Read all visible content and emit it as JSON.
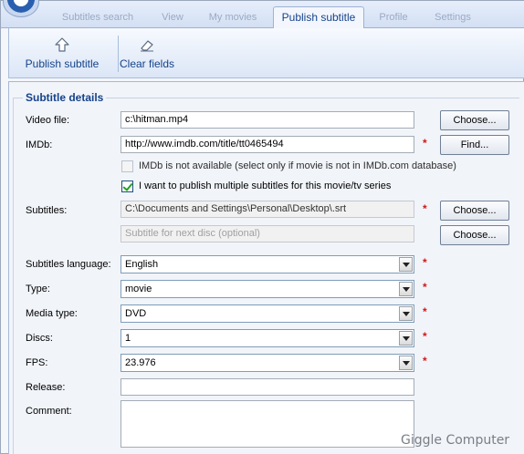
{
  "tabs": [
    {
      "label": "Subtitles search",
      "active": false
    },
    {
      "label": "View",
      "active": false
    },
    {
      "label": "My movies",
      "active": false
    },
    {
      "label": "Publish subtitle",
      "active": true
    },
    {
      "label": "Profile",
      "active": false
    },
    {
      "label": "Settings",
      "active": false
    }
  ],
  "toolbar": {
    "publish_label": "Publish subtitle",
    "clear_label": "Clear fields"
  },
  "section_title": "Subtitle details",
  "form": {
    "video_file": {
      "label": "Video file:",
      "value": "c:\\hitman.mp4",
      "button": "Choose..."
    },
    "imdb": {
      "label": "IMDb:",
      "value": "http://www.imdb.com/title/tt0465494",
      "button": "Find...",
      "required": "*"
    },
    "imdb_not_available": {
      "label": "IMDb is not available (select only if movie is not in IMDb.com database)",
      "checked": false
    },
    "multiple_subtitles": {
      "label": "I want to publish multiple subtitles for this movie/tv series",
      "checked": true
    },
    "subtitles": {
      "label": "Subtitles:",
      "value": "C:\\Documents and Settings\\Personal\\Desktop\\.srt",
      "button": "Choose...",
      "required": "*"
    },
    "next_disc": {
      "placeholder": "Subtitle for next disc (optional)",
      "button": "Choose..."
    },
    "subtitles_language": {
      "label": "Subtitles language:",
      "value": "English",
      "required": "*"
    },
    "type": {
      "label": "Type:",
      "value": "movie",
      "required": "*"
    },
    "media_type": {
      "label": "Media type:",
      "value": "DVD",
      "required": "*"
    },
    "discs": {
      "label": "Discs:",
      "value": "1",
      "required": "*"
    },
    "fps": {
      "label": "FPS:",
      "value": "23.976",
      "required": "*"
    },
    "release": {
      "label": "Release:",
      "value": ""
    },
    "comment": {
      "label": "Comment:",
      "value": ""
    }
  },
  "watermark": "Giggle Computer",
  "icons": {
    "publish": "upload-arrow-icon",
    "clear": "eraser-icon"
  }
}
